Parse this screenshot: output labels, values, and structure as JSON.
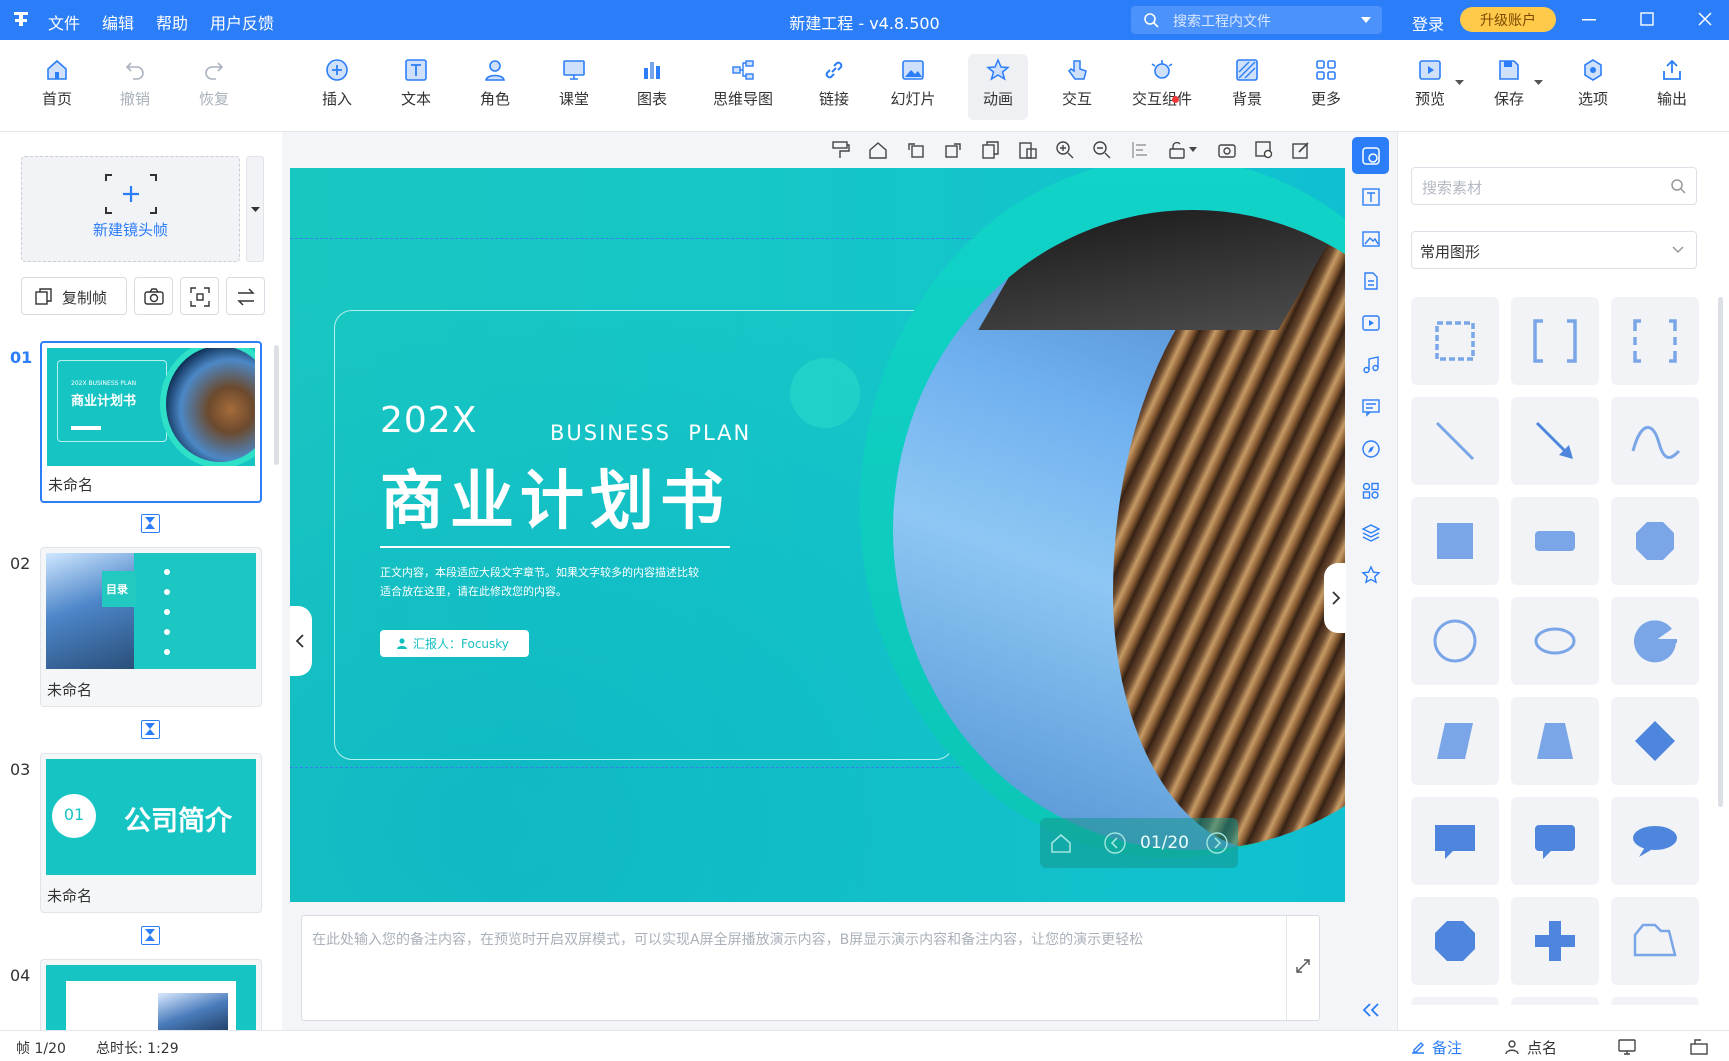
{
  "titlebar": {
    "app_logo": "logo-icon",
    "menus": [
      "文件",
      "编辑",
      "帮助",
      "用户反馈"
    ],
    "title": "新建工程 - v4.8.500",
    "search_placeholder": "搜索工程内文件",
    "login": "登录",
    "upgrade": "升级账户"
  },
  "toolbar": {
    "home": "首页",
    "undo": "撤销",
    "redo": "恢复",
    "insert": "插入",
    "text": "文本",
    "role": "角色",
    "classroom": "课堂",
    "chart": "图表",
    "mindmap": "思维导图",
    "link": "链接",
    "slideshow": "幻灯片",
    "animation": "动画",
    "interact": "交互",
    "widgets": "交互组件",
    "background": "背景",
    "more": "更多",
    "preview": "预览",
    "save": "保存",
    "options": "选项",
    "export": "输出"
  },
  "left": {
    "new_frame": "新建镜头帧",
    "copy_frame": "复制帧",
    "slides": [
      {
        "num": "01",
        "name": "未命名",
        "thumb_title": "商业计划书",
        "thumb_sub": "202X BUSINESS PLAN"
      },
      {
        "num": "02",
        "name": "未命名",
        "thumb_title": "目录"
      },
      {
        "num": "03",
        "name": "未命名",
        "thumb_badge": "01",
        "thumb_title": "公司简介"
      },
      {
        "num": "04",
        "name": ""
      }
    ]
  },
  "slide": {
    "year": "202X",
    "subtitle": "BUSINESS  PLAN",
    "title": "商业计划书",
    "body_line1": "正文内容，本段适应大段文字章节。如果文字较多的内容描述比较",
    "body_line2": "适合放在这里，请在此修改您的内容。",
    "reporter": "汇报人：Focusky",
    "page_indicator": "01/20"
  },
  "notes": {
    "placeholder": "在此处输入您的备注内容，在预览时开启双屏模式，可以实现A屏全屏播放演示内容，B屏显示演示内容和备注内容，让您的演示更轻松"
  },
  "right": {
    "search_placeholder": "搜索素材",
    "category": "常用图形"
  },
  "status": {
    "frame": "帧 1/20",
    "duration": "总时长: 1:29",
    "notes_btn": "备注",
    "rollcall_btn": "点名"
  },
  "colors": {
    "accent": "#2c7ef8",
    "teal": "#16c5c4",
    "upgrade": "#ffc94a",
    "shape_fill": "#7aa6e8"
  }
}
